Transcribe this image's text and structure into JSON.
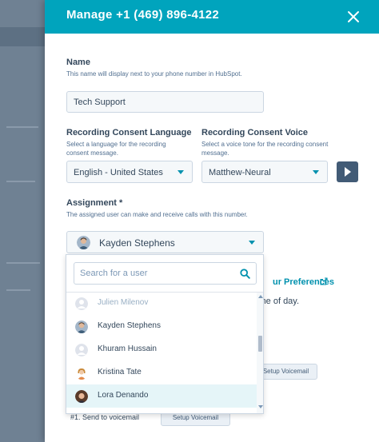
{
  "modal": {
    "title": "Manage +1 (469) 896-4122"
  },
  "name_section": {
    "label": "Name",
    "help": "This name will display next to your phone number in HubSpot.",
    "value": "Tech Support"
  },
  "recording_language": {
    "label": "Recording Consent Language",
    "help": "Select a language for the recording consent message.",
    "value": "English - United States"
  },
  "recording_voice": {
    "label": "Recording Consent Voice",
    "help": "Select a voice tone for the recording consent message.",
    "value": "Matthew-Neural"
  },
  "assignment": {
    "label": "Assignment *",
    "help": "The assigned user can make and receive calls with this number.",
    "selected_user": "Kayden Stephens"
  },
  "dropdown": {
    "search_placeholder": "Search for a user",
    "options": [
      {
        "name": "Julien Milenov",
        "avatar": "default"
      },
      {
        "name": "Kayden Stephens",
        "avatar": "photo"
      },
      {
        "name": "Khuram Hussain",
        "avatar": "default"
      },
      {
        "name": "Kristina Tate",
        "avatar": "photo"
      },
      {
        "name": "Lora Denando",
        "avatar": "photo"
      }
    ]
  },
  "behind": {
    "preferences_link": "ur Preferences",
    "time_text": "time of day.",
    "setup_voicemail_1": "Setup Voicemail",
    "send_text": "#1. Send to voicemail",
    "setup_voicemail_2": "Setup Voicemail"
  },
  "colors": {
    "header": "#00a4bd",
    "accent": "#0091ae",
    "selected_row": "#e5f5f8",
    "play_button": "#425b76"
  }
}
